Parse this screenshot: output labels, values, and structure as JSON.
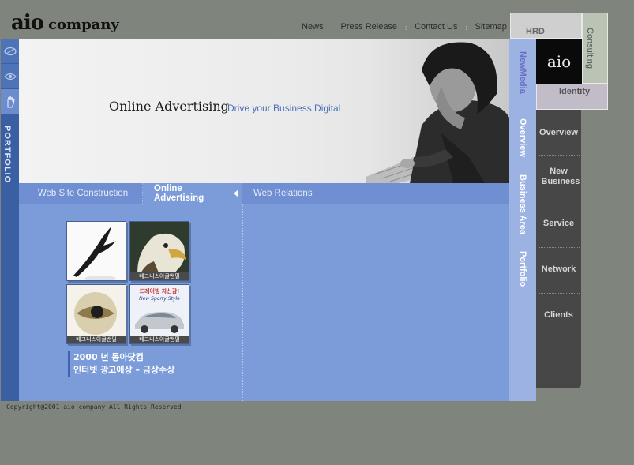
{
  "logo": {
    "primary": "aio",
    "secondary": "company"
  },
  "top_nav": {
    "items": [
      "News",
      "Press Release",
      "Contact Us",
      "Sitemap"
    ]
  },
  "left_bar": {
    "label": "PORTFOLIO",
    "icons": [
      "ring-icon",
      "eye-icon",
      "hand-icon"
    ]
  },
  "banner": {
    "title": "Online Advertising",
    "subtitle": "Drive your Business Digital"
  },
  "submenu": {
    "items": [
      "Web Site Construction",
      "Online Advertising",
      "Web Relations"
    ],
    "active": "Online Advertising"
  },
  "thumbnails": {
    "t2_label": "배그니스아굴밴밀",
    "t3_label": "배그니스아굴밴밀",
    "t4_headline": "드레이빙 자신감!",
    "t4_sub": "New Sporty Style",
    "t4_label": "배그니스아굴밴밀"
  },
  "award": {
    "line1": "2000 년  동아닷컴",
    "line2": "인터넷  광고애상 – 금상수상"
  },
  "vertical_nav": {
    "items": [
      "NewMedia",
      "Overview",
      "Business Area",
      "Portfolio"
    ],
    "active": "NewMedia"
  },
  "dark_menu": {
    "items": [
      "Overview",
      "New Business",
      "Service",
      "Network",
      "Clients"
    ]
  },
  "corner_tabs": {
    "hrd": "HRD",
    "consulting": "Consulting",
    "aio": "aio",
    "identity": "Identity"
  },
  "copyright": "Copyright@2001 aio company All Rights Reserved",
  "colors": {
    "background": "#7f857d",
    "main_blue": "#7b9cd8",
    "submenu_blue": "#6f8fd2",
    "left_bar": "#3a5fa3",
    "vertical_nav": "#9bb2e3",
    "dark_menu": "#474747"
  }
}
